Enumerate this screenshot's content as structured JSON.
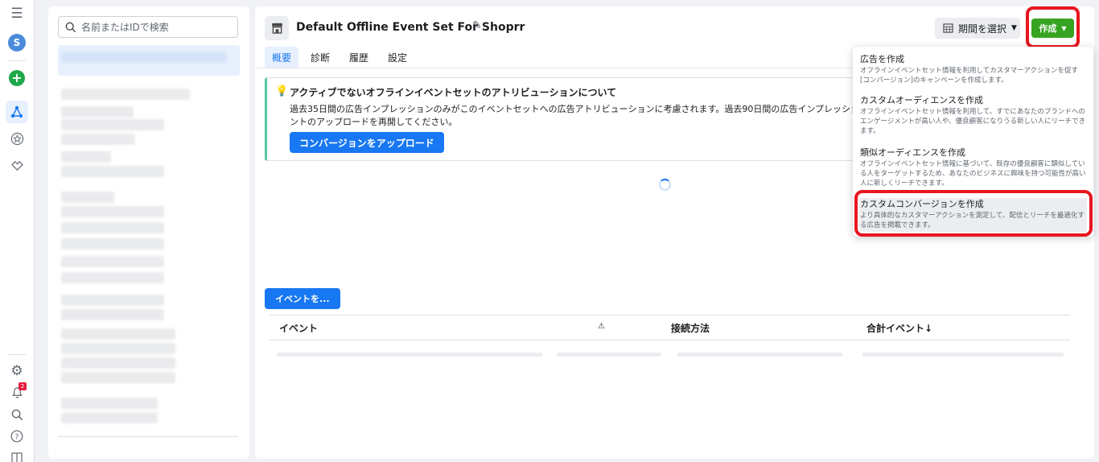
{
  "rail": {
    "avatar_letter": "S",
    "notification_count": "2"
  },
  "list": {
    "search_placeholder": "名前またはIDで検索"
  },
  "main": {
    "title": "Default Offline Event Set For Shoprr",
    "tabs": [
      {
        "label": "概要",
        "active": true
      },
      {
        "label": "診断"
      },
      {
        "label": "履歴"
      },
      {
        "label": "設定"
      }
    ],
    "period_label": "期間を選択",
    "create_label": "作成"
  },
  "notice": {
    "title": "アクティブでないオフラインイベントセットのアトリビューションについて",
    "body_line1": "過去35日間の広告インプレッションのみがこのイベントセットへの広告アトリビューションに考慮されます。過去90日間の広告インプレッションを広",
    "body_line2": "ントのアップロードを再開してください。",
    "upload_label": "コンバージョンをアップロード"
  },
  "events": {
    "button_label": "イベントを...",
    "columns": [
      "イベント",
      "⚠",
      "接続方法",
      "合計イベント↓"
    ]
  },
  "dropdown": {
    "items": [
      {
        "title": "広告を作成",
        "desc": "オフラインイベントセット情報を利用してカスタマーアクションを促す[コンバージョン]のキャンペーンを作成します。"
      },
      {
        "title": "カスタムオーディエンスを作成",
        "desc": "オフラインイベントセット情報を利用して、すでにあなたのブランドへのエンゲージメントが高い人や、優良顧客になりうる新しい人にリーチできます。"
      },
      {
        "title": "類似オーディエンスを作成",
        "desc": "オフラインイベントセット情報に基づいて、既存の優良顧客に類似している人をターゲットするため、あなたのビジネスに興味を持つ可能性が高い人に新しくリーチできます。"
      },
      {
        "title": "カスタムコンバージョンを作成",
        "desc": "より具体的なカスタマーアクションを測定して、配信とリーチを最適化する広告を掲載できます。"
      }
    ]
  },
  "colors": {
    "accent": "#1877f2",
    "create_green": "#36a420",
    "highlight_red": "#e8161f",
    "notice_green": "#58c7a0"
  }
}
